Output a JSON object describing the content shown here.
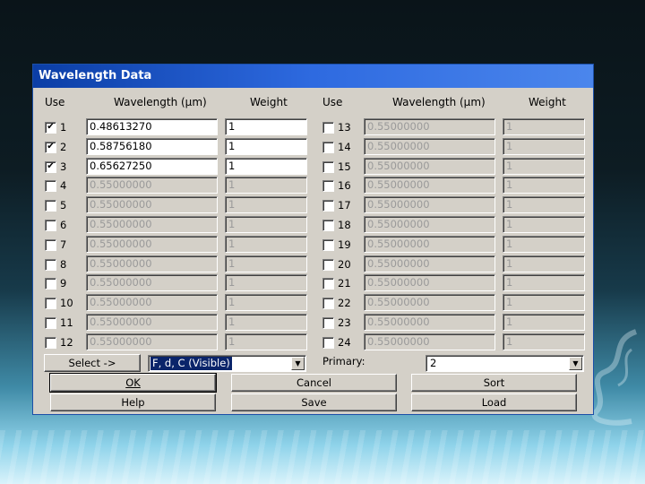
{
  "dialog": {
    "title": "Wavelength Data",
    "headers": {
      "use": "Use",
      "wavelength": "Wavelength (µm)",
      "weight": "Weight"
    },
    "rows": [
      {
        "num": "1",
        "checked": true,
        "wavelength": "0.48613270",
        "weight": "1"
      },
      {
        "num": "2",
        "checked": true,
        "wavelength": "0.58756180",
        "weight": "1"
      },
      {
        "num": "3",
        "checked": true,
        "wavelength": "0.65627250",
        "weight": "1"
      },
      {
        "num": "4",
        "checked": false,
        "wavelength": "0.55000000",
        "weight": "1"
      },
      {
        "num": "5",
        "checked": false,
        "wavelength": "0.55000000",
        "weight": "1"
      },
      {
        "num": "6",
        "checked": false,
        "wavelength": "0.55000000",
        "weight": "1"
      },
      {
        "num": "7",
        "checked": false,
        "wavelength": "0.55000000",
        "weight": "1"
      },
      {
        "num": "8",
        "checked": false,
        "wavelength": "0.55000000",
        "weight": "1"
      },
      {
        "num": "9",
        "checked": false,
        "wavelength": "0.55000000",
        "weight": "1"
      },
      {
        "num": "10",
        "checked": false,
        "wavelength": "0.55000000",
        "weight": "1"
      },
      {
        "num": "11",
        "checked": false,
        "wavelength": "0.55000000",
        "weight": "1"
      },
      {
        "num": "12",
        "checked": false,
        "wavelength": "0.55000000",
        "weight": "1"
      },
      {
        "num": "13",
        "checked": false,
        "wavelength": "0.55000000",
        "weight": "1"
      },
      {
        "num": "14",
        "checked": false,
        "wavelength": "0.55000000",
        "weight": "1"
      },
      {
        "num": "15",
        "checked": false,
        "wavelength": "0.55000000",
        "weight": "1"
      },
      {
        "num": "16",
        "checked": false,
        "wavelength": "0.55000000",
        "weight": "1"
      },
      {
        "num": "17",
        "checked": false,
        "wavelength": "0.55000000",
        "weight": "1"
      },
      {
        "num": "18",
        "checked": false,
        "wavelength": "0.55000000",
        "weight": "1"
      },
      {
        "num": "19",
        "checked": false,
        "wavelength": "0.55000000",
        "weight": "1"
      },
      {
        "num": "20",
        "checked": false,
        "wavelength": "0.55000000",
        "weight": "1"
      },
      {
        "num": "21",
        "checked": false,
        "wavelength": "0.55000000",
        "weight": "1"
      },
      {
        "num": "22",
        "checked": false,
        "wavelength": "0.55000000",
        "weight": "1"
      },
      {
        "num": "23",
        "checked": false,
        "wavelength": "0.55000000",
        "weight": "1"
      },
      {
        "num": "24",
        "checked": false,
        "wavelength": "0.55000000",
        "weight": "1"
      }
    ],
    "select_button": "Select ->",
    "preset_value": "F, d, C (Visible)",
    "primary_label": "Primary:",
    "primary_value": "2",
    "buttons": {
      "ok": "OK",
      "cancel": "Cancel",
      "sort": "Sort",
      "help": "Help",
      "save": "Save",
      "load": "Load"
    }
  },
  "colors": {
    "title_bar": "#0b3ea6",
    "dialog_face": "#d4d0c8",
    "selection": "#0a246a"
  }
}
